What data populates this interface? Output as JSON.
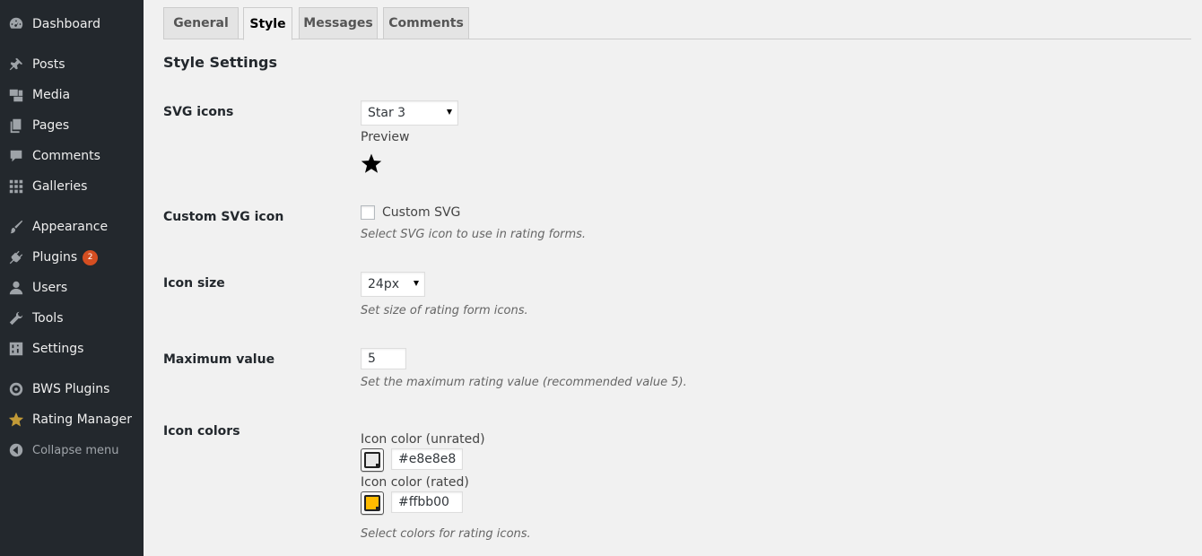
{
  "sidebar": {
    "items": [
      {
        "label": "Dashboard",
        "icon": "dashboard-icon"
      },
      {
        "label": "Posts",
        "icon": "pin-icon"
      },
      {
        "label": "Media",
        "icon": "media-icon"
      },
      {
        "label": "Pages",
        "icon": "pages-icon"
      },
      {
        "label": "Comments",
        "icon": "comment-icon"
      },
      {
        "label": "Galleries",
        "icon": "grid-icon"
      },
      {
        "label": "Appearance",
        "icon": "brush-icon"
      },
      {
        "label": "Plugins",
        "icon": "plug-icon",
        "badge": "2"
      },
      {
        "label": "Users",
        "icon": "user-icon"
      },
      {
        "label": "Tools",
        "icon": "wrench-icon"
      },
      {
        "label": "Settings",
        "icon": "sliders-icon"
      },
      {
        "label": "BWS Plugins",
        "icon": "bws-icon"
      },
      {
        "label": "Rating Manager",
        "icon": "star-icon"
      },
      {
        "label": "Collapse menu",
        "icon": "collapse-icon"
      }
    ]
  },
  "tabs": [
    "General",
    "Style",
    "Messages",
    "Comments"
  ],
  "active_tab": "Style",
  "section_title": "Style Settings",
  "settings": {
    "svg_icons": {
      "label": "SVG icons",
      "selected": "Star 3",
      "preview_label": "Preview"
    },
    "custom_svg": {
      "label": "Custom SVG icon",
      "checkbox_label": "Custom SVG",
      "checked": false,
      "description": "Select SVG icon to use in rating forms."
    },
    "icon_size": {
      "label": "Icon size",
      "selected": "24px",
      "description": "Set size of rating form icons."
    },
    "max_value": {
      "label": "Maximum value",
      "value": "5",
      "description": "Set the maximum rating value (recommended value 5)."
    },
    "icon_colors": {
      "label": "Icon colors",
      "unrated_label": "Icon color (unrated)",
      "unrated_value": "#e8e8e8",
      "rated_label": "Icon color (rated)",
      "rated_value": "#ffbb00",
      "description": "Select colors for rating icons."
    }
  },
  "colors": {
    "sidebar_bg": "#23282d",
    "badge": "#d54e21",
    "unrated": "#e8e8e8",
    "rated": "#ffbb00"
  }
}
